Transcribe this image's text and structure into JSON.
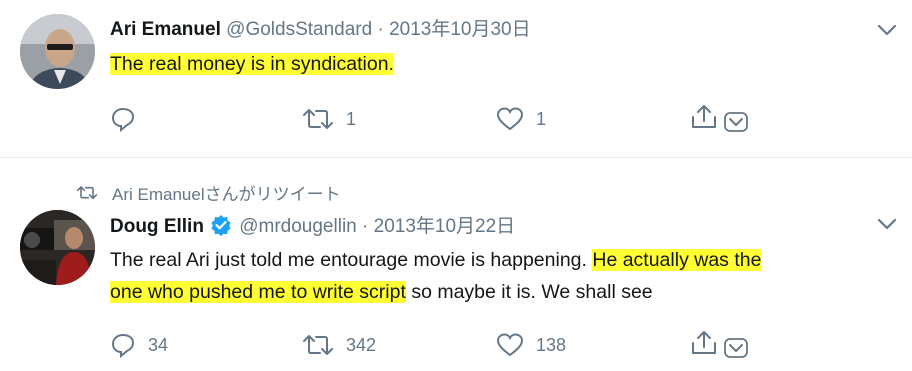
{
  "tweets": [
    {
      "name": "Ari Emanuel",
      "handle": "@GoldsStandard",
      "separator": "·",
      "date": "2013年10月30日",
      "text_parts": [
        "The real money is in syndication."
      ],
      "replies": "",
      "retweets": "1",
      "likes": "1"
    },
    {
      "retweet_label": "Ari Emanuelさんがリツイート",
      "name": "Doug Ellin",
      "handle": "@mrdougellin",
      "separator": "·",
      "date": "2013年10月22日",
      "text_parts": [
        "The real Ari just told me entourage movie is happening. ",
        "He actually was  the",
        "one who pushed me to write script",
        " so maybe it is. We shall see"
      ],
      "replies": "34",
      "retweets": "342",
      "likes": "138"
    }
  ],
  "colors": {
    "highlight": "#ffff33",
    "muted": "#657786",
    "verified": "#1da1f2"
  },
  "icons": [
    "reply-icon",
    "retweet-icon",
    "like-icon",
    "share-icon",
    "chevron-down-icon",
    "verified-badge-icon"
  ]
}
